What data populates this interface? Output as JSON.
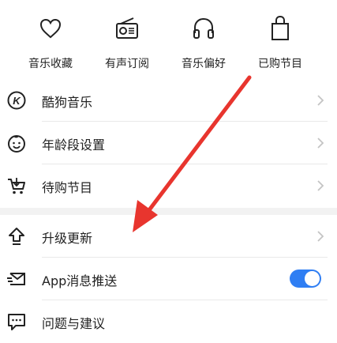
{
  "top_items": [
    {
      "label": "音乐收藏",
      "icon": "heart-icon"
    },
    {
      "label": "有声订阅",
      "icon": "radio-icon"
    },
    {
      "label": "音乐偏好",
      "icon": "headphones-icon"
    },
    {
      "label": "已购节目",
      "icon": "shopping-bag-icon"
    }
  ],
  "menu": {
    "kugou": {
      "label": "酷狗音乐",
      "icon": "kugou-logo-icon"
    },
    "age": {
      "label": "年龄段设置",
      "icon": "baby-face-icon"
    },
    "pending": {
      "label": "待购节目",
      "icon": "cart-icon"
    },
    "upgrade": {
      "label": "升级更新",
      "icon": "upload-arrow-icon"
    },
    "push": {
      "label": "App消息推送",
      "icon": "message-icon",
      "enabled": true
    },
    "feedback": {
      "label": "问题与建议",
      "icon": "chat-icon"
    }
  },
  "colors": {
    "accent": "#2f7ef3",
    "annotation_arrow": "#e8352e",
    "divider": "#e9e9e9",
    "chevron": "#c4c4c4"
  }
}
